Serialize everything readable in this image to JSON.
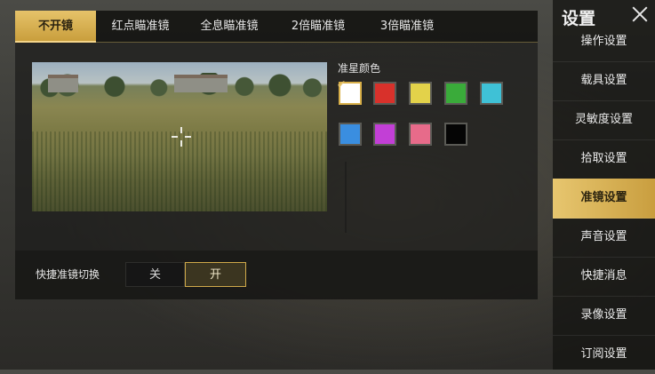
{
  "tabs": [
    {
      "label": "不开镜",
      "active": true
    },
    {
      "label": "红点瞄准镜",
      "active": false
    },
    {
      "label": "全息瞄准镜",
      "active": false
    },
    {
      "label": "2倍瞄准镜",
      "active": false
    },
    {
      "label": "3倍瞄准镜",
      "active": false
    }
  ],
  "crosshair_color": {
    "label": "准星颜色",
    "selected": "#ffffff",
    "swatches": [
      "#ffffff",
      "#d8312b",
      "#e3d24a",
      "#3aab3a",
      "#3fc1d6",
      "#3a8ee0",
      "#c23fd6",
      "#e76b8a",
      "#050505"
    ]
  },
  "quick_switch": {
    "label": "快捷准镜切换",
    "off_label": "关",
    "on_label": "开",
    "value": "开"
  },
  "sidebar": {
    "title": "设置",
    "items": [
      {
        "label": "操作设置",
        "active": false
      },
      {
        "label": "载具设置",
        "active": false
      },
      {
        "label": "灵敏度设置",
        "active": false
      },
      {
        "label": "拾取设置",
        "active": false
      },
      {
        "label": "准镜设置",
        "active": true
      },
      {
        "label": "声音设置",
        "active": false
      },
      {
        "label": "快捷消息",
        "active": false
      },
      {
        "label": "录像设置",
        "active": false
      },
      {
        "label": "订阅设置",
        "active": false
      }
    ]
  },
  "colors": {
    "accent_gold": "#d9b04a",
    "panel_dark": "#1c1c1a"
  }
}
